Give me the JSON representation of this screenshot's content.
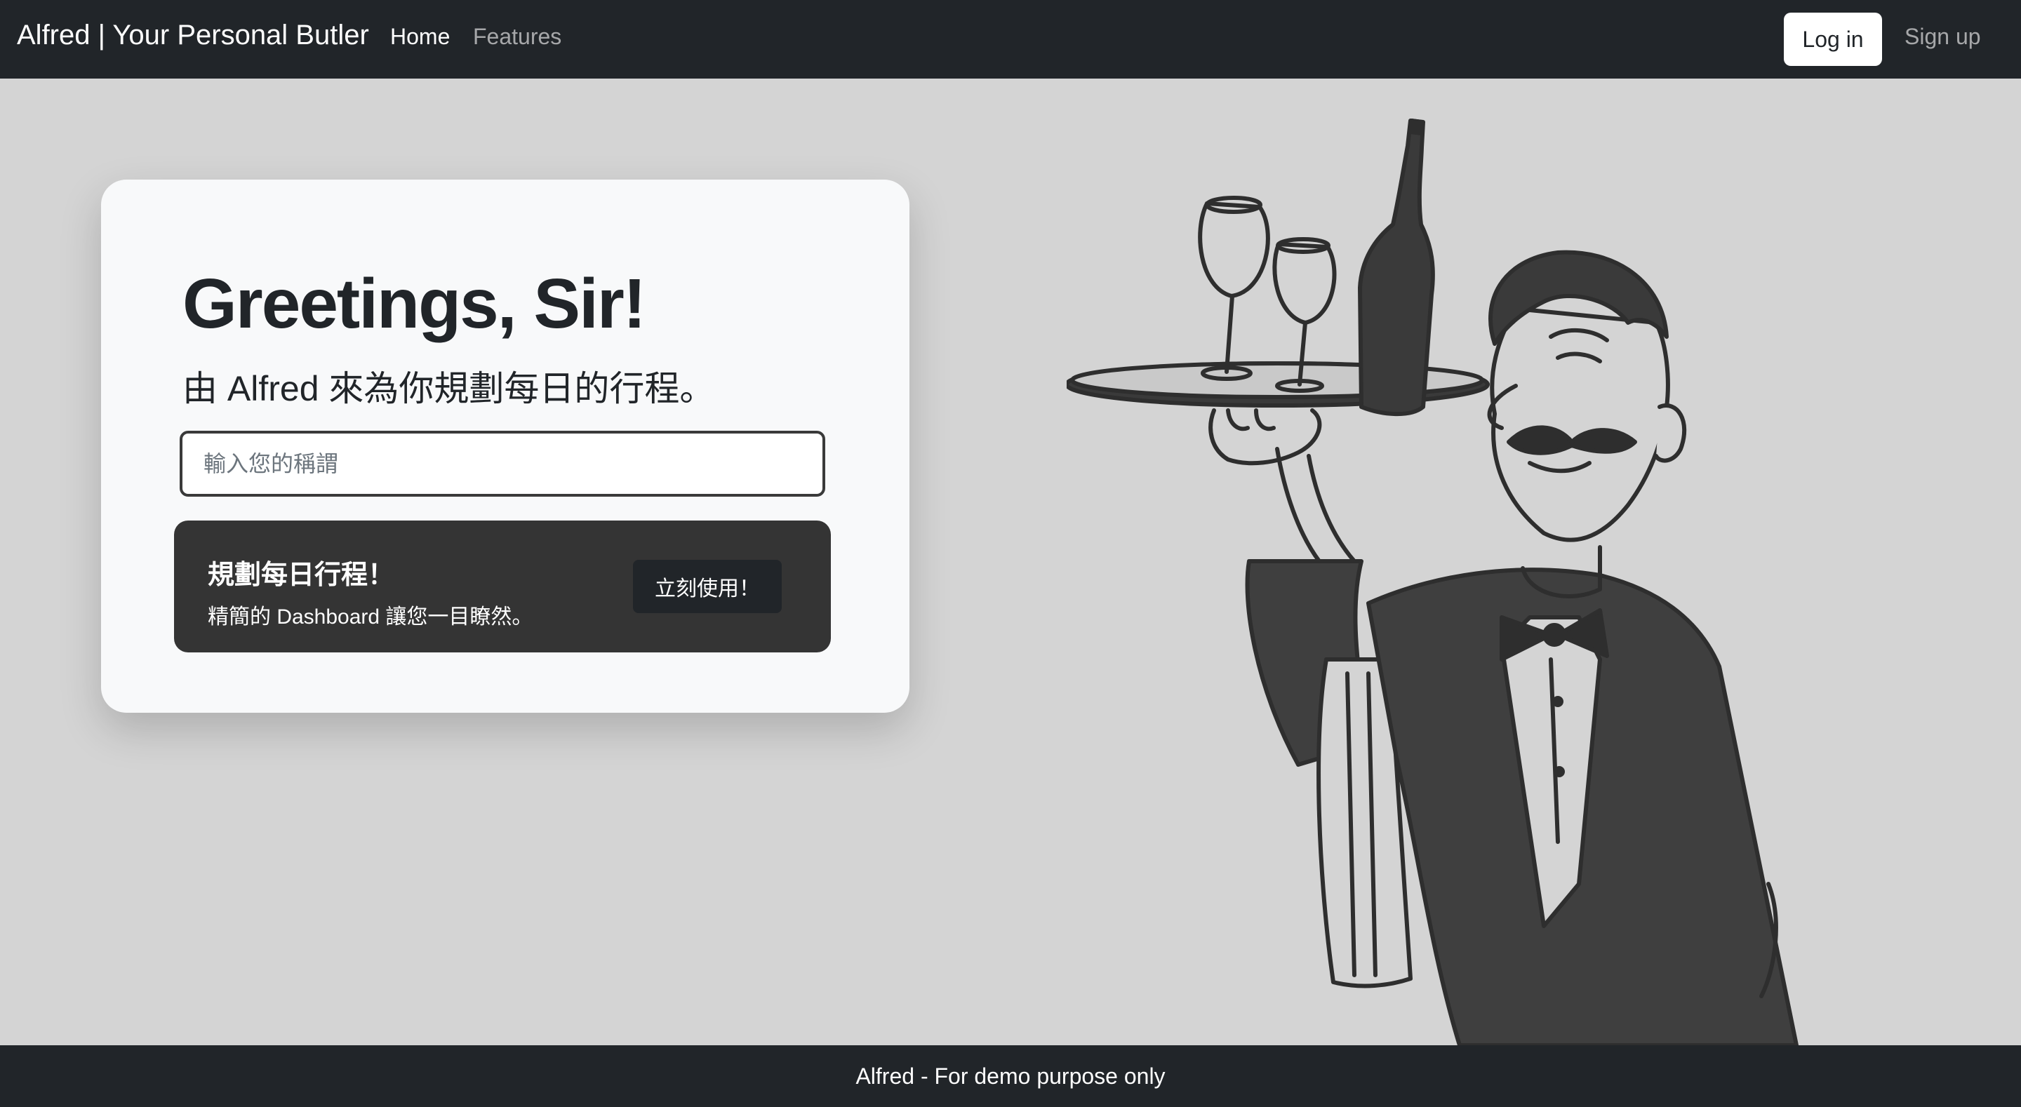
{
  "navbar": {
    "brand": "Alfred | Your Personal Butler",
    "links": [
      {
        "label": "Home"
      },
      {
        "label": "Features"
      }
    ],
    "login_label": "Log in",
    "signup_label": "Sign up"
  },
  "hero": {
    "heading": "Greetings, Sir!",
    "subheading": "由 Alfred 來為你規劃每日的行程。",
    "name_input": {
      "placeholder": "輸入您的稱謂",
      "value": ""
    },
    "promo": {
      "title": "規劃每日行程！",
      "description": "精簡的 Dashboard 讓您一目瞭然。",
      "button_label": "立刻使用！"
    }
  },
  "illustration": {
    "icon": "butler-illustration"
  },
  "footer": {
    "text": "Alfred - For demo purpose only"
  },
  "colors": {
    "navbar_bg": "#212529",
    "page_bg": "#d4d4d4",
    "card_bg": "#f8f9fa",
    "promo_bg": "#343434"
  }
}
